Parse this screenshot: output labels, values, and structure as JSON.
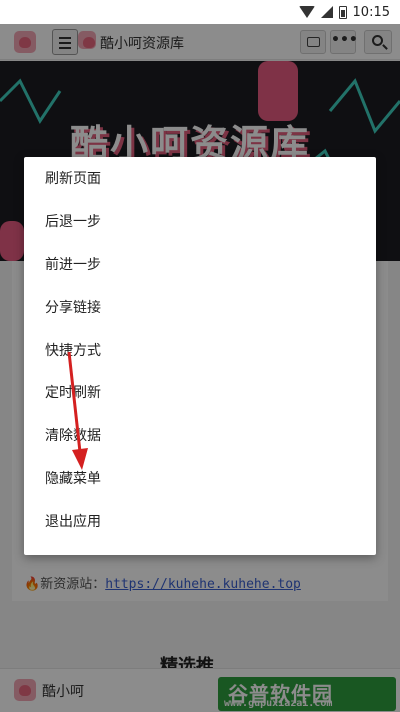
{
  "status_bar": {
    "time": "10:15"
  },
  "app_bar": {
    "title": "酷小呵资源库"
  },
  "banner": {
    "title": "酷小呵资源库"
  },
  "menu": {
    "items": [
      {
        "label": "刷新页面"
      },
      {
        "label": "后退一步"
      },
      {
        "label": "前进一步"
      },
      {
        "label": "分享链接"
      },
      {
        "label": "快捷方式"
      },
      {
        "label": "定时刷新"
      },
      {
        "label": "清除数据"
      },
      {
        "label": "隐藏菜单"
      },
      {
        "label": "退出应用"
      }
    ]
  },
  "content": {
    "new_site_label": "新资源站：",
    "new_site_url": "https://kuhehe.kuhehe.top",
    "section_title": "精选推"
  },
  "bottom_bar": {
    "title": "酷小呵"
  },
  "watermark": {
    "main": "谷普软件园",
    "sub": "www.gupuxiazai.com"
  },
  "colors": {
    "annotation_arrow": "#d42020",
    "watermark_bg": "#2f9f3f"
  }
}
